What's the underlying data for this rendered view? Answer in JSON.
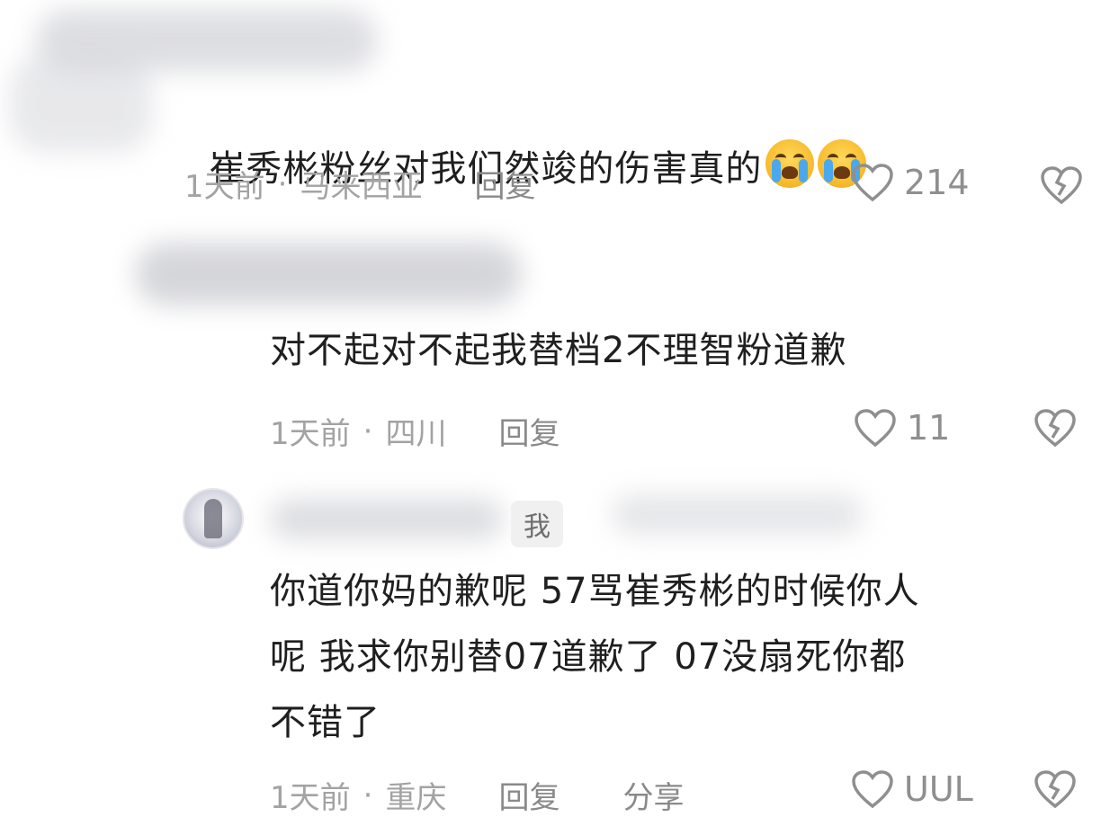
{
  "comments": [
    {
      "text_main": "崔秀彬粉丝对我们然竣的伤害真的",
      "emojis": [
        "loudly-crying-face",
        "loudly-crying-face"
      ],
      "time": "1天前",
      "separator": "·",
      "location": "马来西亚",
      "reply_label": "回复",
      "likes": "214"
    },
    {
      "text": "对不起对不起我替档2不理智粉道歉",
      "time": "1天前",
      "separator": "·",
      "location": "四川",
      "reply_label": "回复",
      "likes": "11"
    },
    {
      "badge": "我",
      "text": "你道你妈的歉呢 57骂崔秀彬的时候你人\n呢 我求你别替07道歉了 07没扇死你都\n不错了",
      "time": "1天前",
      "separator": "·",
      "location": "重庆",
      "reply_label": "回复",
      "share_label": "分享",
      "likes": "UUL"
    }
  ],
  "colors": {
    "meta": "#a3a3a3",
    "text": "#1f1f1f",
    "icon": "#8f8f8f"
  }
}
